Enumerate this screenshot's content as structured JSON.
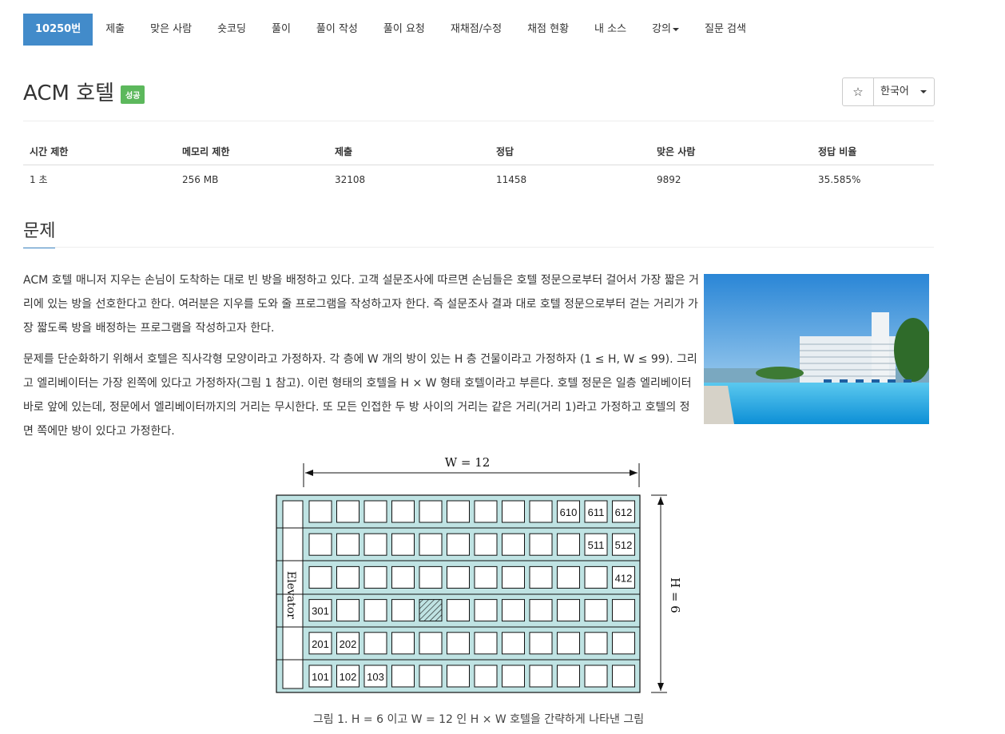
{
  "nav": {
    "problem_id": "10250번",
    "items": [
      "제출",
      "맞은 사람",
      "숏코딩",
      "풀이",
      "풀이 작성",
      "풀이 요청",
      "재채점/수정",
      "채점 현황",
      "내 소스",
      "강의",
      "질문 검색"
    ]
  },
  "header": {
    "title": "ACM 호텔",
    "badge": "성공",
    "star": "☆",
    "language": "한국어"
  },
  "stats": {
    "headers": [
      "시간 제한",
      "메모리 제한",
      "제출",
      "정답",
      "맞은 사람",
      "정답 비율"
    ],
    "values": [
      "1 초",
      "256 MB",
      "32108",
      "11458",
      "9892",
      "35.585%"
    ]
  },
  "section": {
    "title": "문제"
  },
  "paragraphs": [
    "ACM 호텔 매니저 지우는 손님이 도착하는 대로 빈 방을 배정하고 있다. 고객 설문조사에 따르면 손님들은 호텔 정문으로부터 걸어서 가장 짧은 거리에 있는 방을 선호한다고 한다. 여러분은 지우를 도와 줄 프로그램을 작성하고자 한다. 즉 설문조사 결과 대로 호텔 정문으로부터 걷는 거리가 가장 짧도록 방을 배정하는 프로그램을 작성하고자 한다.",
    "문제를 단순화하기 위해서 호텔은 직사각형 모양이라고 가정하자. 각 층에 W 개의 방이 있는 H 층 건물이라고 가정하자 (1 ≤ H, W ≤ 99). 그리고 엘리베이터는 가장 왼쪽에 있다고 가정하자(그림 1 참고). 이런 형태의 호텔을 H × W 형태 호텔이라고 부른다. 호텔 정문은 일층 엘리베이터 바로 앞에 있는데, 정문에서 엘리베이터까지의 거리는 무시한다. 또 모든 인접한 두 방 사이의 거리는 같은 거리(거리 1)라고 가정하고 호텔의 정면 쪽에만 방이 있다고 가정한다."
  ],
  "figure": {
    "w_label": "W = 12",
    "h_label": "H = 6",
    "elevator_label": "Elevator",
    "room_labels": {
      "row6": [
        "610",
        "611",
        "612"
      ],
      "row5": [
        "511",
        "512"
      ],
      "row4": [
        "412"
      ],
      "row3": [
        "301"
      ],
      "row2": [
        "201",
        "202"
      ],
      "row1": [
        "101",
        "102",
        "103"
      ]
    },
    "colors": {
      "background": "#bfe3e3",
      "room": "#ffffff",
      "stroke": "#111111"
    }
  },
  "caption": "그림 1. H = 6 이고 W = 12 인 H × W 호텔을 간략하게 나타낸 그림"
}
